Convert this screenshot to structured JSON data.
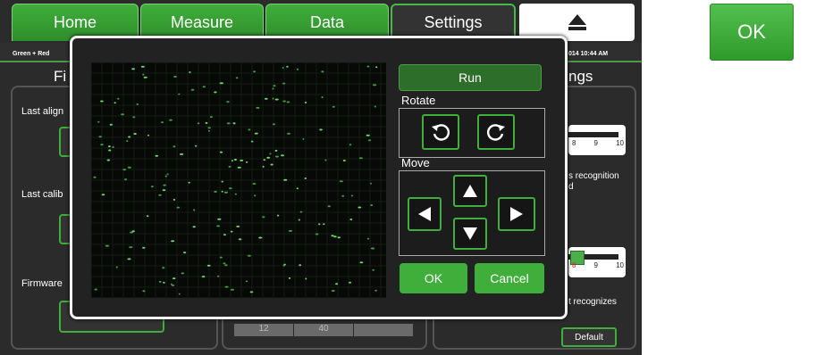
{
  "tabs": [
    {
      "label": "Home"
    },
    {
      "label": "Measure"
    },
    {
      "label": "Data"
    },
    {
      "label": "Settings"
    }
  ],
  "status": {
    "left": "Green + Red",
    "right": "014  10:44 AM"
  },
  "background": {
    "left_heading": "Fi",
    "right_heading": "ngs",
    "labels": [
      "Last align",
      "Last calib",
      "Firmware"
    ],
    "right_texts": [
      "s recognition",
      "d",
      "t recognizes"
    ],
    "slider_ticks": [
      "8",
      "9",
      "10"
    ],
    "default_label": "Default",
    "bottom_cells": [
      "12",
      "40",
      ""
    ]
  },
  "dialog": {
    "run_label": "Run",
    "rotate_label": "Rotate",
    "move_label": "Move",
    "ok_label": "OK",
    "cancel_label": "Cancel"
  },
  "side_ok_label": "OK",
  "colors": {
    "accent": "#3fae3a",
    "dark_accent": "#2e6e2b",
    "panel": "#2b2b2b"
  },
  "icons": [
    "eject-icon",
    "rotate-ccw-icon",
    "rotate-cw-icon",
    "arrow-up-icon",
    "arrow-left-icon",
    "arrow-right-icon",
    "arrow-down-icon"
  ]
}
